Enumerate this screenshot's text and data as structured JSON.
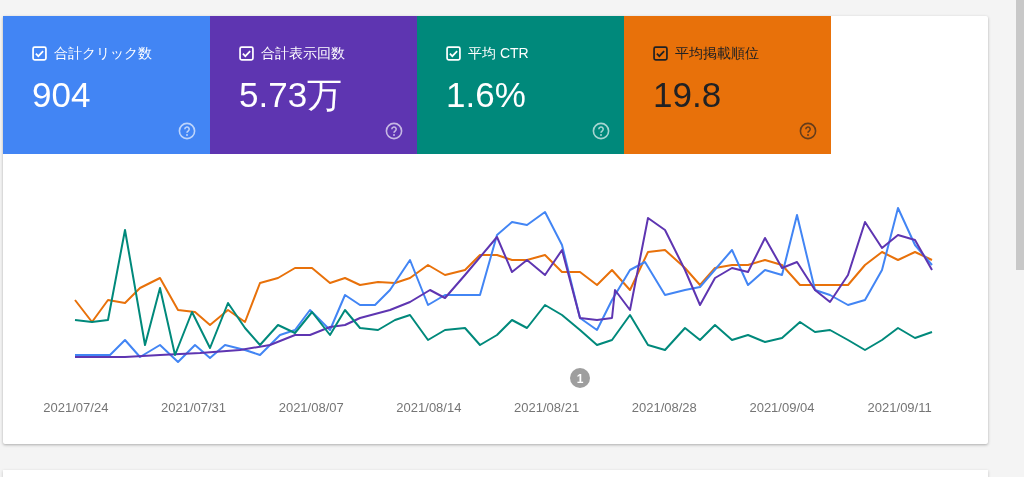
{
  "metrics": [
    {
      "label": "合計クリック数",
      "value": "904",
      "checked": true,
      "color": "#4285f4"
    },
    {
      "label": "合計表示回数",
      "value": "5.73万",
      "checked": true,
      "color": "#5e35b1"
    },
    {
      "label": "平均 CTR",
      "value": "1.6%",
      "checked": true,
      "color": "#00897b"
    },
    {
      "label": "平均掲載順位",
      "value": "19.8",
      "checked": true,
      "color": "#e8710a"
    }
  ],
  "chart": {
    "marker": "1",
    "dates": [
      "2021/07/24",
      "2021/07/31",
      "2021/08/07",
      "2021/08/14",
      "2021/08/21",
      "2021/08/28",
      "2021/09/04",
      "2021/09/11"
    ]
  }
}
